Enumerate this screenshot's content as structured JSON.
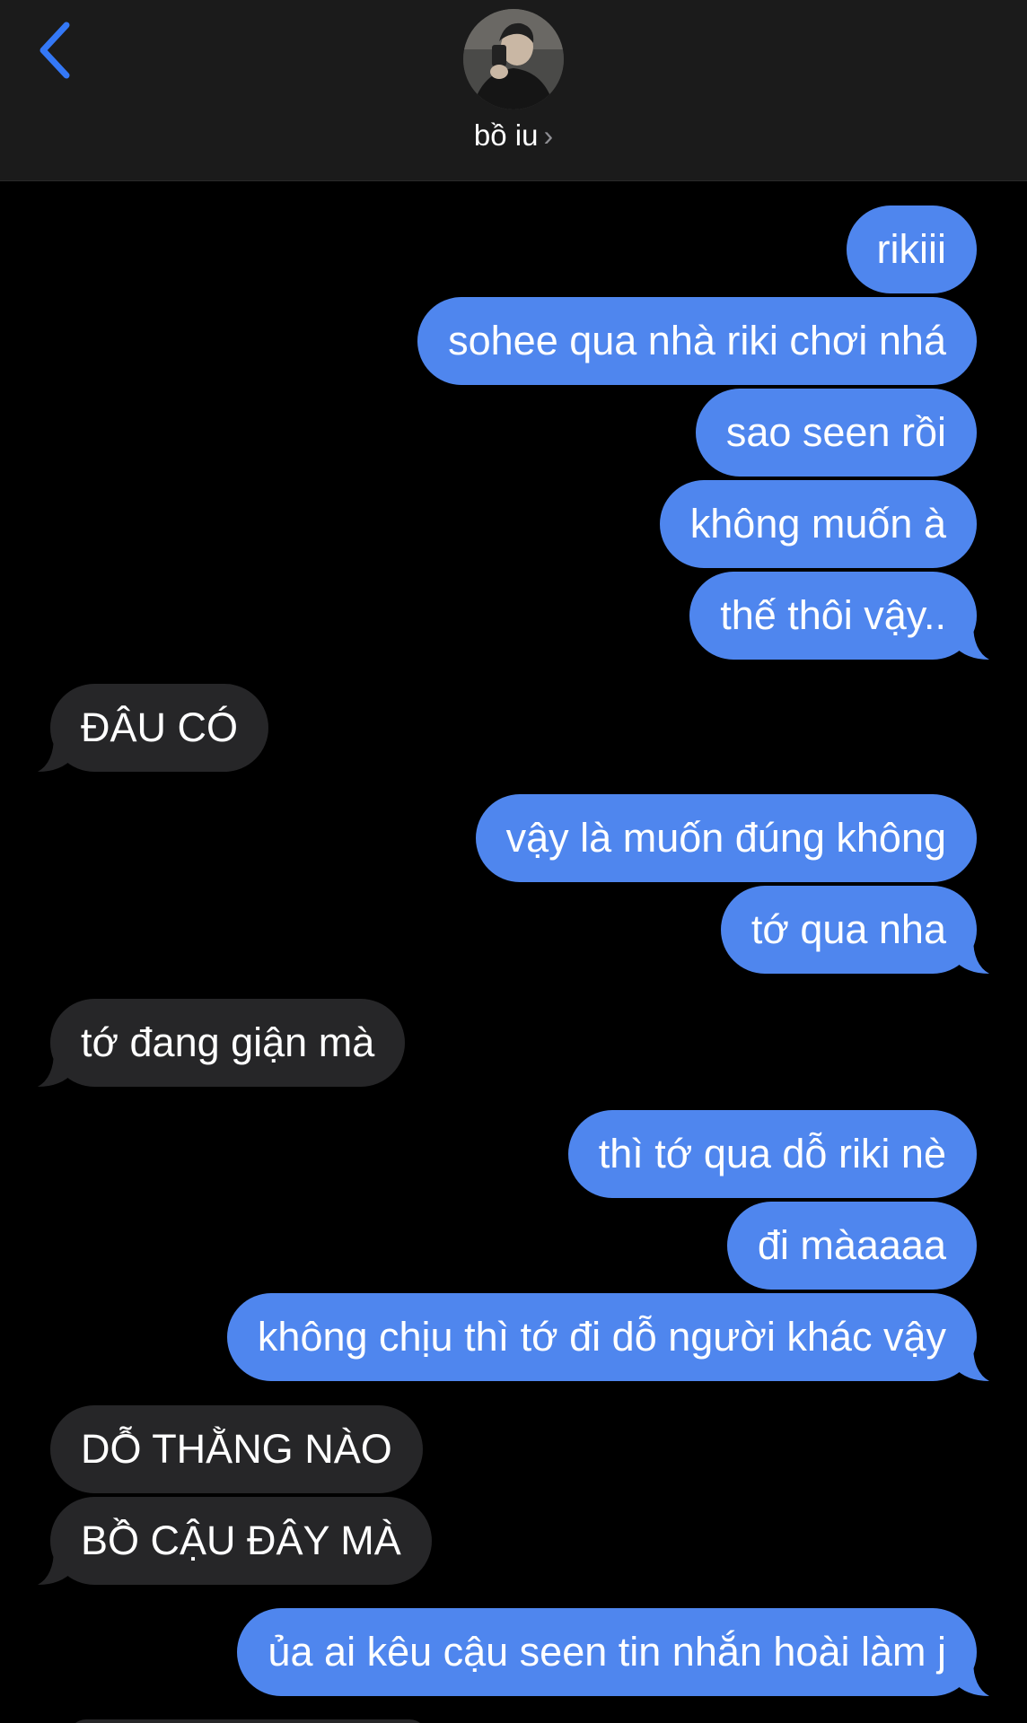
{
  "header": {
    "contact_name": "bồ iu",
    "chevron": "›",
    "back_icon": "chevron-left-icon",
    "accent": "#3478f6"
  },
  "colors": {
    "sent": "#4f86ee",
    "received": "#262628",
    "background": "#000000",
    "header_bg": "#1b1b1b"
  },
  "messages": [
    {
      "dir": "sent",
      "text": "rikiii"
    },
    {
      "dir": "sent",
      "text": "sohee qua nhà riki chơi nhá"
    },
    {
      "dir": "sent",
      "text": "sao seen rồi"
    },
    {
      "dir": "sent",
      "text": "không muốn à"
    },
    {
      "dir": "sent",
      "text": "thế thôi vậy.."
    },
    {
      "dir": "received",
      "text": "ĐÂU CÓ"
    },
    {
      "dir": "sent",
      "text": "vậy là muốn đúng không"
    },
    {
      "dir": "sent",
      "text": "tớ qua nha"
    },
    {
      "dir": "received",
      "text": "tớ đang giận mà"
    },
    {
      "dir": "sent",
      "text": "thì tớ qua dỗ riki nè"
    },
    {
      "dir": "sent",
      "text": "đi màaaaa"
    },
    {
      "dir": "sent",
      "text": "không chịu thì tớ đi dỗ người khác vậy"
    },
    {
      "dir": "received",
      "text": "DỖ THẰNG NÀO"
    },
    {
      "dir": "received",
      "text": "BỒ CẬU ĐÂY MÀ"
    },
    {
      "dir": "sent",
      "text": "ủa ai kêu cậu seen tin nhắn hoài làm j"
    }
  ]
}
